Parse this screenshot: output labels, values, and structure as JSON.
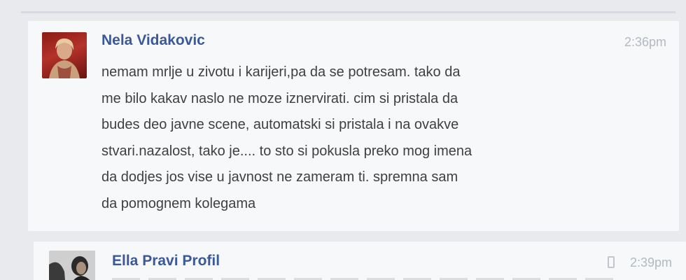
{
  "messages": [
    {
      "sender": "Nela Vidakovic",
      "time": "2:36pm",
      "avatar_icon": "profile-photo-icon",
      "text": "nemam mrlje u zivotu i karijeri,pa da se potresam. tako da\nme bilo kakav naslo ne moze iznervirati. cim si pristala da\nbudes deo javne scene, automatski si pristala i na ovakve\nstvari.nazalost, tako je.... to sto si pokusla preko mog imena\nda dodjes jos vise u javnost ne zameram ti. spremna sam\nda pomognem kolegama"
    },
    {
      "sender": "Ella Pravi Profil",
      "time": "2:39pm",
      "avatar_icon": "profile-photo-icon",
      "device_icon": "mobile-phone-icon"
    }
  ],
  "colors": {
    "sender_name": "#3b5998",
    "timestamp": "#b4b8bf",
    "message_text": "#3f3f3f",
    "background": "#e8eaee"
  }
}
